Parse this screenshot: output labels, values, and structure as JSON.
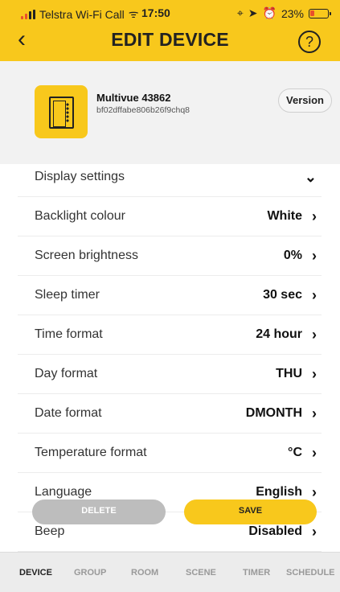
{
  "status_bar": {
    "carrier": "Telstra Wi-Fi Call",
    "time": "17:50",
    "battery_percent": "23%",
    "icons": [
      "signal-icon",
      "wifi-icon",
      "location-icon",
      "alarm-icon",
      "battery-icon"
    ]
  },
  "header": {
    "title": "EDIT DEVICE",
    "back_icon": "chevron-left-icon",
    "help_icon": "question-circle-icon",
    "back_glyph": "‹",
    "help_glyph": "?"
  },
  "device": {
    "name": "Multivue 43862",
    "id": "bf02dffabe806b26f9chq8",
    "version_label": "Version"
  },
  "settings": [
    {
      "label": "Display settings",
      "value": "",
      "chevron": "⌄"
    },
    {
      "label": "Backlight colour",
      "value": "White",
      "chevron": "›"
    },
    {
      "label": "Screen brightness",
      "value": "0%",
      "chevron": "›"
    },
    {
      "label": "Sleep timer",
      "value": "30 sec",
      "chevron": "›"
    },
    {
      "label": "Time format",
      "value": "24 hour",
      "chevron": "›"
    },
    {
      "label": "Day format",
      "value": "THU",
      "chevron": "›"
    },
    {
      "label": "Date format",
      "value": "DMONTH",
      "chevron": "›"
    },
    {
      "label": "Temperature format",
      "value": "°C",
      "chevron": "›"
    },
    {
      "label": "Language",
      "value": "English",
      "chevron": "›"
    },
    {
      "label": "Beep",
      "value": "Disabled",
      "chevron": "›"
    }
  ],
  "actions": {
    "delete": "DELETE",
    "save": "SAVE"
  },
  "tabs": [
    {
      "label": "DEVICE",
      "active": true
    },
    {
      "label": "GROUP",
      "active": false
    },
    {
      "label": "ROOM",
      "active": false
    },
    {
      "label": "SCENE",
      "active": false
    },
    {
      "label": "TIMER",
      "active": false
    },
    {
      "label": "SCHEDULE",
      "active": false
    }
  ],
  "colors": {
    "accent": "#f8c81c",
    "background": "#ffffff",
    "panel": "#f2f2f2",
    "delete_button": "#bdbdbd",
    "text": "#222222"
  }
}
